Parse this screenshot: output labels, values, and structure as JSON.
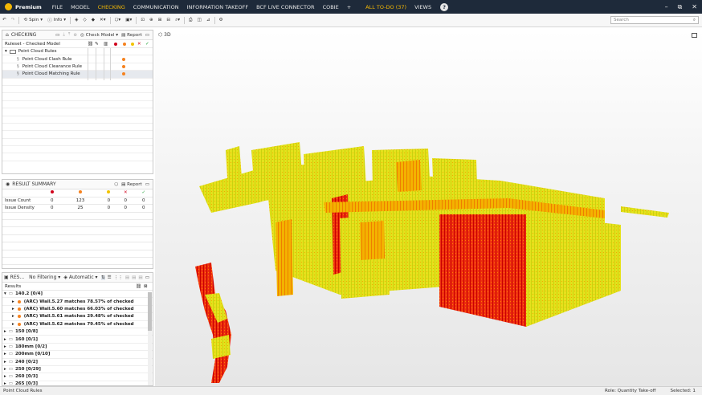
{
  "app": {
    "name": "Premium",
    "help_label": "?"
  },
  "menu": [
    "FILE",
    "MODEL",
    "CHECKING",
    "COMMUNICATION",
    "INFORMATION TAKEOFF",
    "BCF LIVE CONNECTOR",
    "COBIE",
    "+"
  ],
  "menu_active": "CHECKING",
  "todo": "ALL TO-DO (37)",
  "views": "VIEWS",
  "window_controls": {
    "minimize": "–",
    "restore": "⧉",
    "close": "✕"
  },
  "toolbar": {
    "spin": "Spin",
    "info": "Info",
    "search_placeholder": "Search"
  },
  "checking": {
    "title": "CHECKING",
    "check_model": "Check Model",
    "report": "Report",
    "ruleset": "Ruleset - Checked Model",
    "group": "Point Cloud Rules",
    "rules": [
      {
        "name": "Point Cloud Clash Rule"
      },
      {
        "name": "Point Cloud Clearance Rule"
      },
      {
        "name": "Point Cloud Matching Rule"
      }
    ]
  },
  "summary": {
    "title": "RESULT SUMMARY",
    "report": "Report",
    "rows": [
      {
        "label": "Issue Count",
        "values": [
          "0",
          "123",
          "0",
          "0",
          "0"
        ]
      },
      {
        "label": "Issue Density",
        "values": [
          "0",
          "25",
          "0",
          "0",
          "0"
        ]
      }
    ]
  },
  "results": {
    "title": "RES...",
    "filter": "No Filtering",
    "mode": "Automatic",
    "header": "Results",
    "open_group": "140.2 [0/4]",
    "items": [
      "(ARC) Wall.5.27 matches 78.57% of checked point clo",
      "(ARC) Wall.5.60 matches 66.03% of checked point clo",
      "(ARC) Wall.5.61 matches 29.48% of checked point clo",
      "(ARC) Wall.5.62 matches 79.45% of checked point clo"
    ],
    "groups": [
      "150 [0/8]",
      "160 [0/1]",
      "180mm [0/2]",
      "200mm [0/10]",
      "240 [0/2]",
      "250 [0/29]",
      "260 [0/3]",
      "265 [0/3]"
    ]
  },
  "view3d": {
    "label": "3D"
  },
  "status": {
    "left": "Point Cloud Rules",
    "role": "Role: Quantity Take-off",
    "selected": "Selected: 1"
  },
  "colors": {
    "critical": "#d0021b",
    "moderate": "#f5821f",
    "low": "#f2c300",
    "rejected": "#d0021b",
    "accepted": "#2aa640",
    "accent": "#f2b705"
  }
}
